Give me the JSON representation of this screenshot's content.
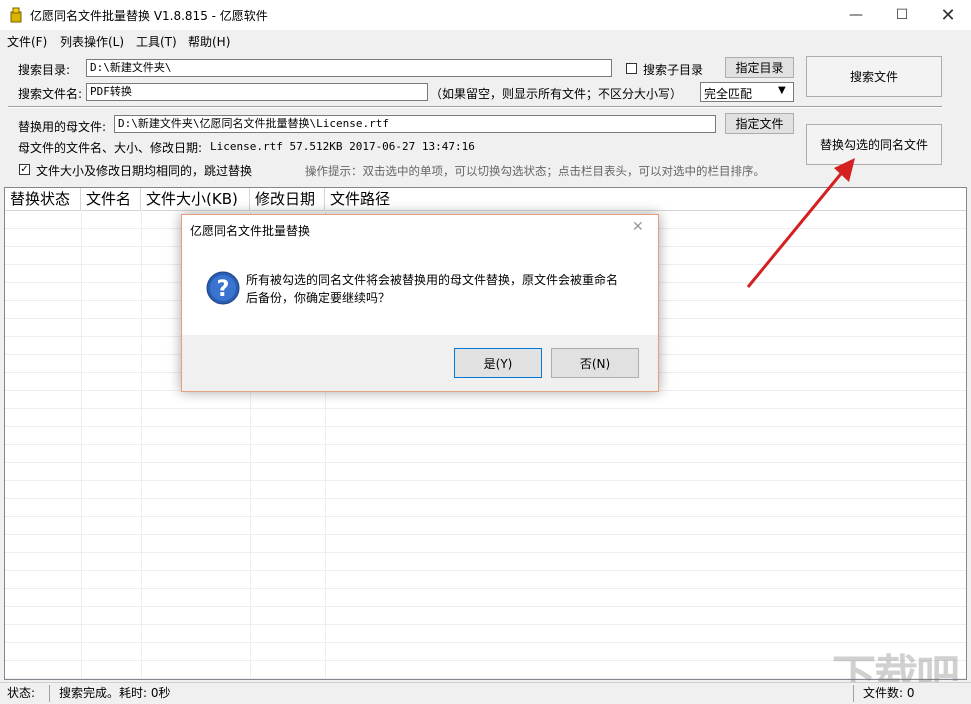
{
  "window": {
    "title": "亿愿同名文件批量替换 V1.8.815 - 亿愿软件"
  },
  "menu": [
    "文件(F)",
    "列表操作(L)",
    "工具(T)",
    "帮助(H)"
  ],
  "form": {
    "search_dir_label": "搜索目录:",
    "search_dir_value": "D:\\新建文件夹\\",
    "subdir_label": "搜索子目录",
    "subdir_checked": false,
    "pick_dir_button": "指定目录",
    "search_button": "搜索文件",
    "filename_label": "搜索文件名:",
    "filename_value": "PDF转换",
    "filename_hint": "（如果留空，则显示所有文件；不区分大小写）",
    "match_mode": "完全匹配",
    "master_file_label": "替换用的母文件:",
    "master_file_value": "D:\\新建文件夹\\亿愿同名文件批量替换\\License.rtf",
    "pick_file_button": "指定文件",
    "master_info_label": "母文件的文件名、大小、修改日期:",
    "master_info_value": "License.rtf 57.512KB 2017-06-27 13:47:16",
    "replace_button": "替换勾选的同名文件",
    "skip_label": "文件大小及修改日期均相同的，跳过替换",
    "skip_checked": true,
    "tip": "操作提示：双击选中的单项，可以切换勾选状态；点击栏目表头，可以对选中的栏目排序。"
  },
  "columns": [
    "替换状态",
    "文件名",
    "文件大小(KB)",
    "修改日期",
    "文件路径"
  ],
  "dialog": {
    "title": "亿愿同名文件批量替换",
    "message_line1": "所有被勾选的同名文件将会被替换用的母文件替换，原文件会被重命名",
    "message_line2": "后备份，你确定要继续吗？",
    "yes_button": "是(Y)",
    "no_button": "否(N)"
  },
  "status": {
    "state_label": "状态:",
    "state_value": "搜索完成。耗时: 0秒",
    "file_count": "文件数: 0"
  },
  "watermark": "下载吧",
  "colors": {
    "arrow": "#d42020",
    "dialog_border": "#e3a07b",
    "help_icon": "#2a5db0"
  }
}
